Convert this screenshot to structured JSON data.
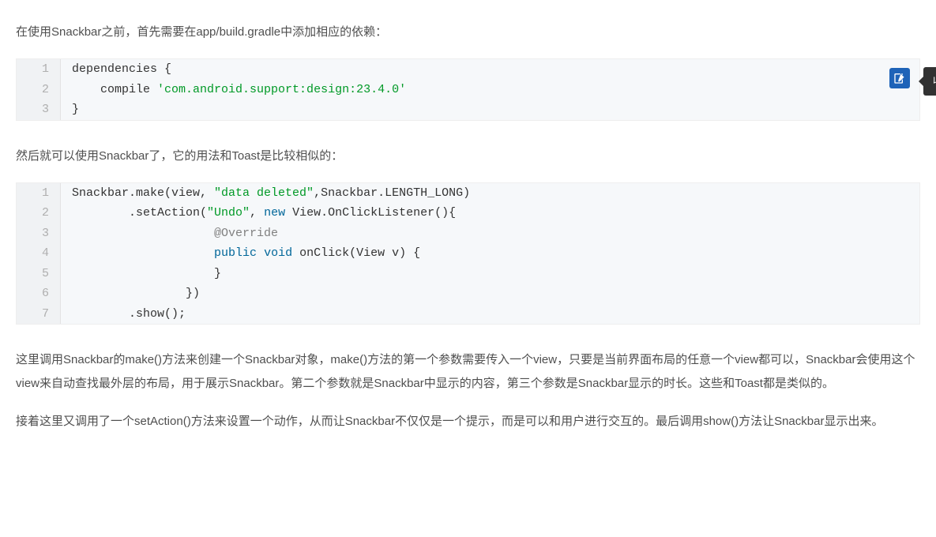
{
  "para1": "在使用Snackbar之前，首先需要在app/build.gradle中添加相应的依赖：",
  "code1": {
    "rows": [
      {
        "n": 1,
        "spans": [
          {
            "t": "dependencies {",
            "c": ""
          }
        ]
      },
      {
        "n": 2,
        "spans": [
          {
            "t": "    compile ",
            "c": ""
          },
          {
            "t": "'com.android.support:design:23.4.0'",
            "c": "tok-str"
          }
        ]
      },
      {
        "n": 3,
        "spans": [
          {
            "t": "}",
            "c": ""
          }
        ]
      }
    ]
  },
  "bookmark_tooltip": "收藏到代码笔记",
  "para2": "然后就可以使用Snackbar了，它的用法和Toast是比较相似的：",
  "code2": {
    "rows": [
      {
        "n": 1,
        "spans": [
          {
            "t": "Snackbar.make(view, ",
            "c": ""
          },
          {
            "t": "\"data deleted\"",
            "c": "tok-str"
          },
          {
            "t": ",Snackbar.LENGTH_LONG)",
            "c": ""
          }
        ]
      },
      {
        "n": 2,
        "spans": [
          {
            "t": "        .setAction(",
            "c": ""
          },
          {
            "t": "\"Undo\"",
            "c": "tok-str"
          },
          {
            "t": ", ",
            "c": ""
          },
          {
            "t": "new",
            "c": "tok-key"
          },
          {
            "t": " View.OnClickListener(){",
            "c": ""
          }
        ]
      },
      {
        "n": 3,
        "spans": [
          {
            "t": "                    ",
            "c": ""
          },
          {
            "t": "@Override",
            "c": "tok-ann"
          }
        ]
      },
      {
        "n": 4,
        "spans": [
          {
            "t": "                    ",
            "c": ""
          },
          {
            "t": "public",
            "c": "tok-key"
          },
          {
            "t": " ",
            "c": ""
          },
          {
            "t": "void",
            "c": "tok-key"
          },
          {
            "t": " onClick(View v) {",
            "c": ""
          }
        ]
      },
      {
        "n": 5,
        "spans": [
          {
            "t": "                    }",
            "c": ""
          }
        ]
      },
      {
        "n": 6,
        "spans": [
          {
            "t": "                })",
            "c": ""
          }
        ]
      },
      {
        "n": 7,
        "spans": [
          {
            "t": "        .show();",
            "c": ""
          }
        ]
      }
    ]
  },
  "para3": "这里调用Snackbar的make()方法来创建一个Snackbar对象，make()方法的第一个参数需要传入一个view，只要是当前界面布局的任意一个view都可以，Snackbar会使用这个view来自动查找最外层的布局，用于展示Snackbar。第二个参数就是Snackbar中显示的内容，第三个参数是Snackbar显示的时长。这些和Toast都是类似的。",
  "para4": "接着这里又调用了一个setAction()方法来设置一个动作，从而让Snackbar不仅仅是一个提示，而是可以和用户进行交互的。最后调用show()方法让Snackbar显示出来。"
}
